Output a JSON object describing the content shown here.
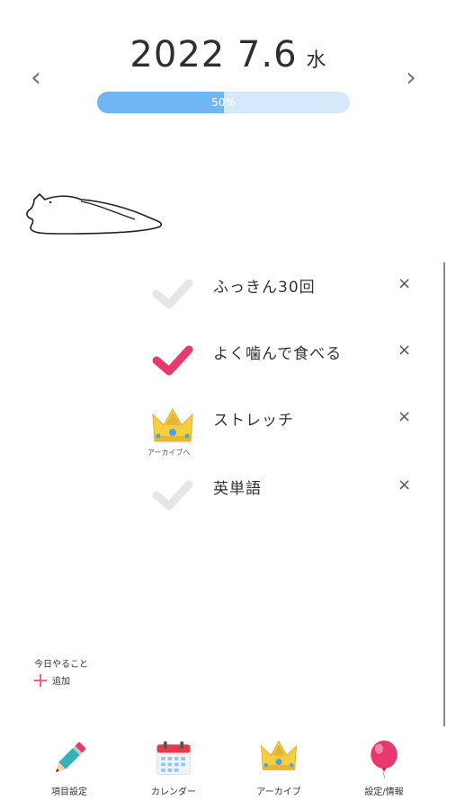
{
  "header": {
    "date": "2022 7.6",
    "weekday": "水",
    "prev_icon": "chevron-left-icon",
    "next_icon": "chevron-right-icon",
    "prev_glyph": "‹",
    "next_glyph": "›",
    "progress_label": "50%",
    "progress_fraction": 0.5
  },
  "tasks": [
    {
      "label": "ふっきん30回",
      "status": "unchecked",
      "icon": "check-icon",
      "delete": "×"
    },
    {
      "label": "よく噛んで食べる",
      "status": "checked",
      "icon": "check-icon",
      "delete": "×"
    },
    {
      "label": "ストレッチ",
      "status": "archive",
      "icon": "crown-icon",
      "caption": "アーカイブへ",
      "delete": "×"
    },
    {
      "label": "英単語",
      "status": "unchecked",
      "icon": "check-icon",
      "delete": "×"
    }
  ],
  "add": {
    "title": "今日やること",
    "button_label": "追加"
  },
  "tabbar": [
    {
      "label": "項目設定",
      "icon": "pencil-icon"
    },
    {
      "label": "カレンダー",
      "icon": "calendar-icon"
    },
    {
      "label": "アーカイブ",
      "icon": "crown-icon"
    },
    {
      "label": "設定/情報",
      "icon": "balloon-icon"
    }
  ],
  "colors": {
    "progress_fill": "#6fb6f2",
    "progress_track": "#d5e9fb",
    "check_done": "#e8386d",
    "check_todo": "#e6e6e6",
    "crown": "#f6cf3c"
  }
}
